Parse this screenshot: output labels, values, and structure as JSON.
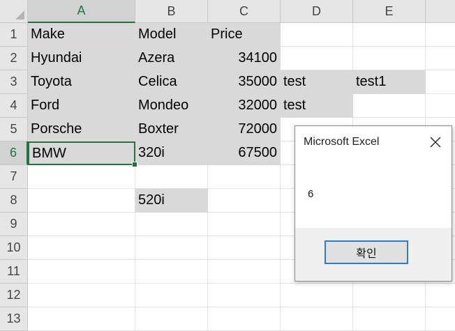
{
  "columns": [
    "A",
    "B",
    "C",
    "D",
    "E"
  ],
  "rows": [
    "1",
    "2",
    "3",
    "4",
    "5",
    "6",
    "7",
    "8",
    "9",
    "10",
    "11",
    "12",
    "13"
  ],
  "cells": {
    "A1": "Make",
    "B1": "Model",
    "C1": "Price",
    "A2": "Hyundai",
    "B2": "Azera",
    "C2": "34100",
    "A3": "Toyota",
    "B3": "Celica",
    "C3": "35000",
    "D3": "test",
    "E3": "test1",
    "A4": "Ford",
    "B4": "Mondeo",
    "C4": "32000",
    "D4": "test",
    "A5": "Porsche",
    "B5": "Boxter",
    "C5": "72000",
    "A6": "BMW",
    "B6": "320i",
    "C6": "67500",
    "B8": "520i"
  },
  "active_cell": "A6",
  "colors": {
    "accent": "#217346",
    "cell_fill": "#d9d9d9",
    "header_bg": "#e6e6e6",
    "dialog_button_border": "#2c7cd4"
  },
  "dialog": {
    "title": "Microsoft Excel",
    "message": "6",
    "ok_label": "확인",
    "close_icon": "close-icon"
  }
}
